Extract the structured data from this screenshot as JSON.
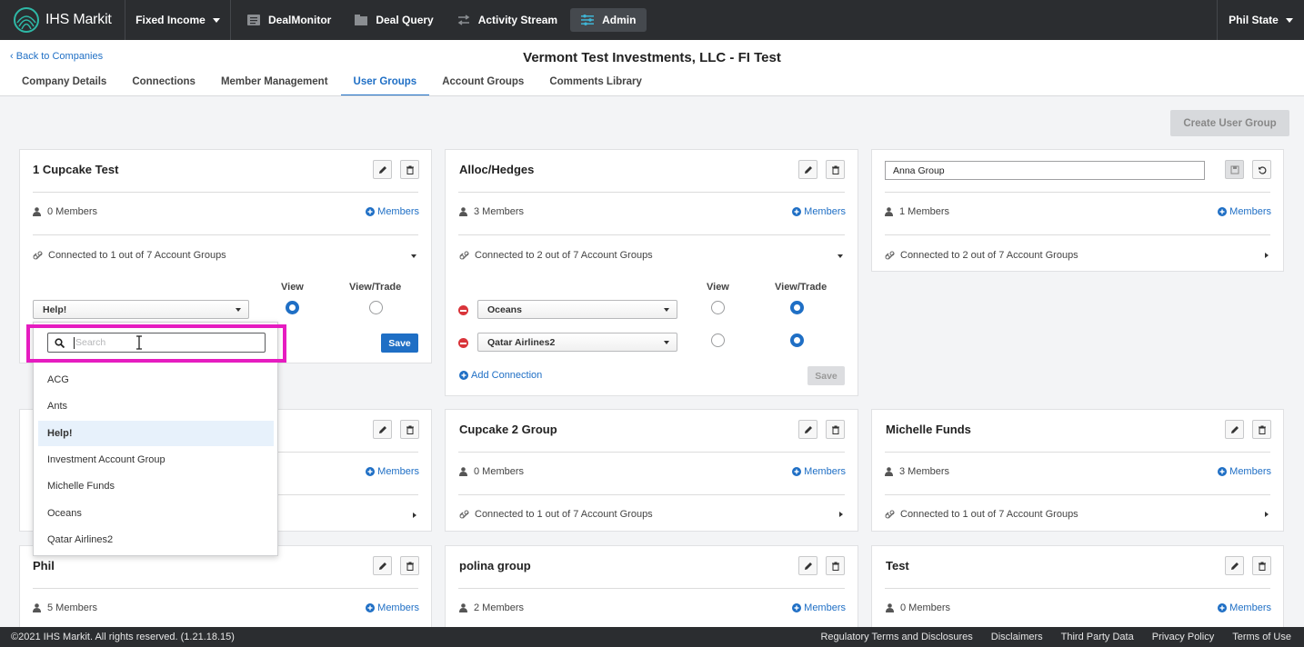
{
  "topnav": {
    "brand": "IHS Markit",
    "product": "Fixed Income",
    "items": [
      {
        "label": "DealMonitor",
        "icon": "list-icon"
      },
      {
        "label": "Deal Query",
        "icon": "folder-icon"
      },
      {
        "label": "Activity Stream",
        "icon": "arrows-icon"
      },
      {
        "label": "Admin",
        "icon": "sliders-icon"
      }
    ],
    "user": "Phil State"
  },
  "header": {
    "back_label": "Back to Companies",
    "company_title": "Vermont Test Investments, LLC - FI Test",
    "tabs": [
      "Company Details",
      "Connections",
      "Member Management",
      "User Groups",
      "Account Groups",
      "Comments Library"
    ],
    "active_tab": "User Groups"
  },
  "create_button": "Create User Group",
  "labels": {
    "members_link": "Members",
    "view": "View",
    "view_trade": "View/Trade",
    "save": "Save",
    "add_connection": "Add Connection"
  },
  "cards": {
    "cupcake": {
      "title": "1 Cupcake Test",
      "members": "0 Members",
      "connected": "Connected to 1 out of 7 Account Groups",
      "selected_group": "Help!",
      "view": "selected"
    },
    "alloc": {
      "title": "Alloc/Hedges",
      "members": "3 Members",
      "connected": "Connected to 2 out of 7 Account Groups",
      "rows": [
        {
          "group": "Oceans",
          "access": "View/Trade"
        },
        {
          "group": "Qatar Airlines2",
          "access": "View/Trade"
        }
      ]
    },
    "anna": {
      "input_value": "Anna Group",
      "members": "1 Members",
      "connected": "Connected to 2 out of 7 Account Groups"
    },
    "hidden": {
      "connected": ""
    },
    "cupcake2": {
      "title": "Cupcake 2 Group",
      "members": "0 Members",
      "connected": "Connected to 1 out of 7 Account Groups"
    },
    "michelle": {
      "title": "Michelle Funds",
      "members": "3 Members",
      "connected": "Connected to 1 out of 7 Account Groups"
    },
    "phil": {
      "title": "Phil",
      "members": "5 Members"
    },
    "polina": {
      "title": "polina group",
      "members": "2 Members"
    },
    "test": {
      "title": "Test",
      "members": "0 Members"
    }
  },
  "dropdown": {
    "search_placeholder": "Search",
    "options": [
      "ACG",
      "Ants",
      "Help!",
      "Investment Account Group",
      "Michelle Funds",
      "Oceans",
      "Qatar Airlines2"
    ],
    "highlighted": "Help!"
  },
  "footer": {
    "copyright": "©2021 IHS Markit. All rights reserved. (1.21.18.15)",
    "links": [
      "Regulatory Terms and Disclosures",
      "Disclaimers",
      "Third Party Data",
      "Privacy Policy",
      "Terms of Use"
    ]
  },
  "colors": {
    "nav_bg": "#2b2d30",
    "accent": "#1f6fc5",
    "highlight": "#e61cc0",
    "remove": "#d9343a"
  }
}
